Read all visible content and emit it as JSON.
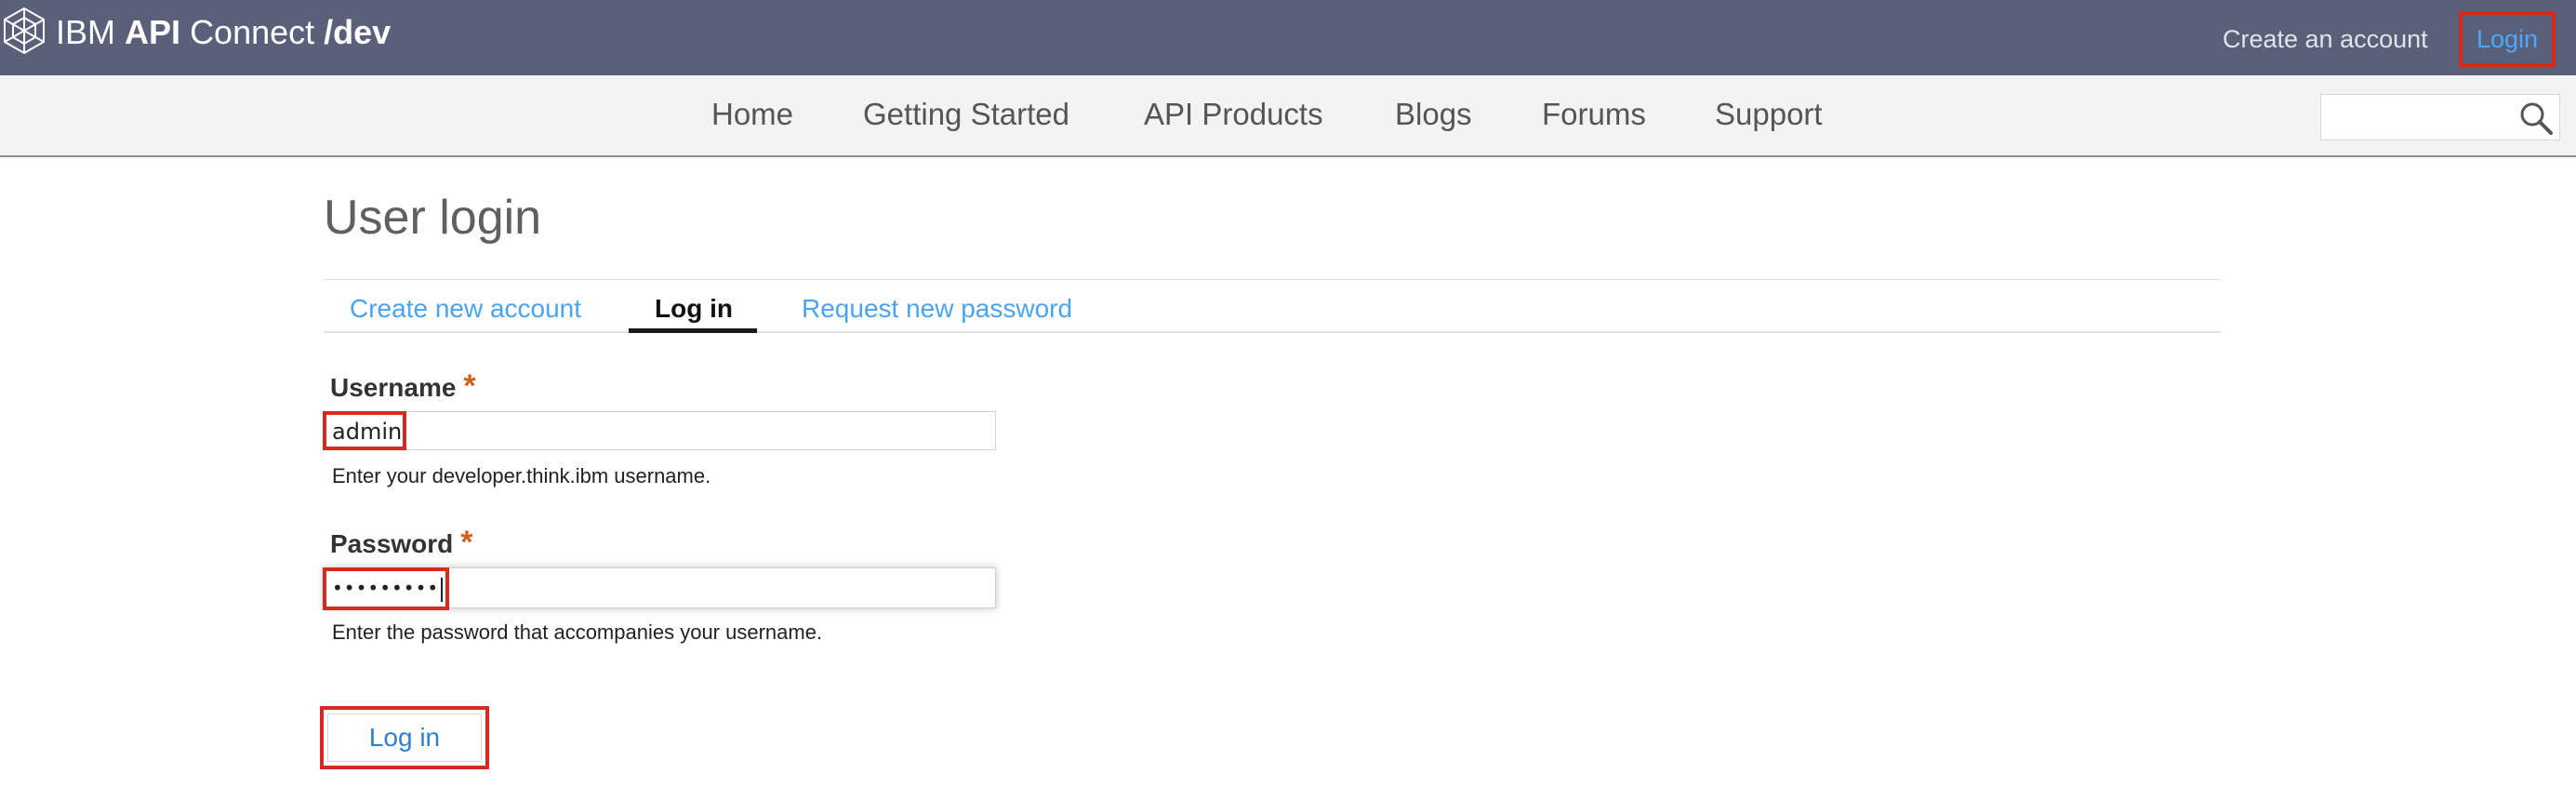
{
  "header": {
    "brand_ibm": "IBM",
    "brand_api": "API",
    "brand_connect": "Connect",
    "brand_env": "/dev",
    "create_account": "Create an account",
    "login": "Login"
  },
  "nav": {
    "items": [
      {
        "label": "Home"
      },
      {
        "label": "Getting Started"
      },
      {
        "label": "API Products"
      },
      {
        "label": "Blogs"
      },
      {
        "label": "Forums"
      },
      {
        "label": "Support"
      }
    ],
    "search_value": ""
  },
  "main": {
    "title": "User login",
    "tabs": [
      {
        "label": "Create new account",
        "active": false
      },
      {
        "label": "Log in",
        "active": true
      },
      {
        "label": "Request new password",
        "active": false
      }
    ],
    "username": {
      "label": "Username",
      "required_mark": "*",
      "value": "admin",
      "help": "Enter your developer.think.ibm username."
    },
    "password": {
      "label": "Password",
      "required_mark": "*",
      "value": "•••••••••",
      "help": "Enter the password that accompanies your username."
    },
    "submit_label": "Log in"
  },
  "colors": {
    "header_bg": "#5a6079",
    "nav_bg": "#f3f3f3",
    "link_blue": "#4aa3f0",
    "highlight_red": "#d42a1f",
    "required_orange": "#d0601b"
  },
  "icons": {
    "logo": "ibm-globe-icon",
    "search": "search-icon"
  }
}
